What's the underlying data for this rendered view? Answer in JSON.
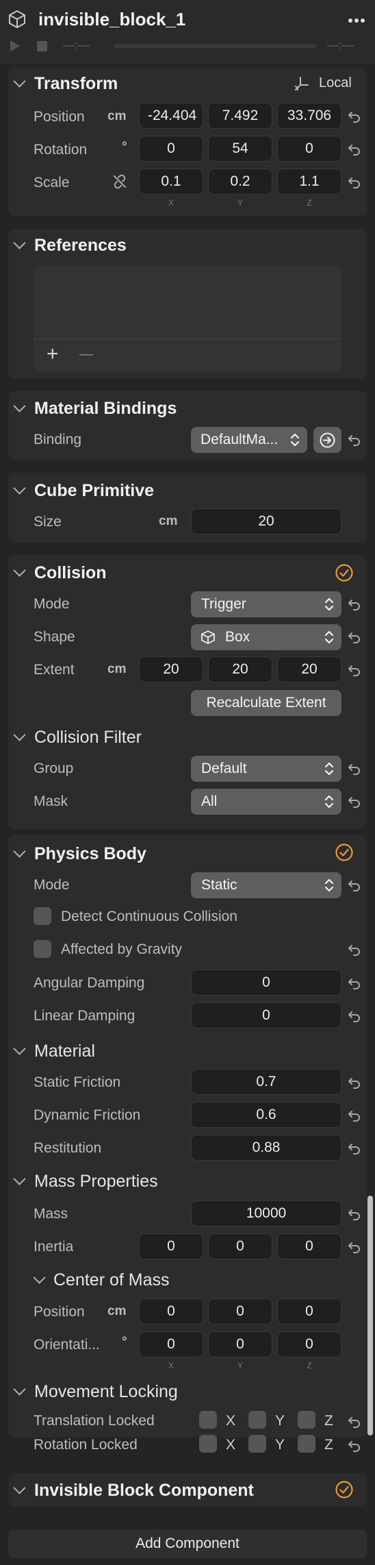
{
  "header": {
    "title": "invisible_block_1",
    "time_start": "—:—",
    "time_end": "—:—"
  },
  "transform": {
    "title": "Transform",
    "space": "Local",
    "position_label": "Position",
    "position_unit": "cm",
    "position": [
      "-24.404",
      "7.492",
      "33.706"
    ],
    "rotation_label": "Rotation",
    "rotation_unit": "°",
    "rotation": [
      "0",
      "54",
      "0"
    ],
    "scale_label": "Scale",
    "scale": [
      "0.1",
      "0.2",
      "1.1"
    ],
    "axes": [
      "X",
      "Y",
      "Z"
    ]
  },
  "references": {
    "title": "References",
    "add": "+",
    "remove": "—"
  },
  "material_bindings": {
    "title": "Material Bindings",
    "binding_label": "Binding",
    "binding_value": "DefaultMa..."
  },
  "cube_primitive": {
    "title": "Cube Primitive",
    "size_label": "Size",
    "size_unit": "cm",
    "size_value": "20"
  },
  "collision": {
    "title": "Collision",
    "mode_label": "Mode",
    "mode_value": "Trigger",
    "shape_label": "Shape",
    "shape_value": "Box",
    "extent_label": "Extent",
    "extent_unit": "cm",
    "extent": [
      "20",
      "20",
      "20"
    ],
    "recalc_label": "Recalculate Extent",
    "filter_title": "Collision Filter",
    "group_label": "Group",
    "group_value": "Default",
    "mask_label": "Mask",
    "mask_value": "All"
  },
  "physics_body": {
    "title": "Physics Body",
    "mode_label": "Mode",
    "mode_value": "Static",
    "continuous_label": "Detect Continuous Collision",
    "gravity_label": "Affected by Gravity",
    "angular_damping_label": "Angular Damping",
    "angular_damping": "0",
    "linear_damping_label": "Linear Damping",
    "linear_damping": "0",
    "material_title": "Material",
    "static_friction_label": "Static Friction",
    "static_friction": "0.7",
    "dynamic_friction_label": "Dynamic Friction",
    "dynamic_friction": "0.6",
    "restitution_label": "Restitution",
    "restitution": "0.88",
    "mass_title": "Mass Properties",
    "mass_label": "Mass",
    "mass": "10000",
    "inertia_label": "Inertia",
    "inertia": [
      "0",
      "0",
      "0"
    ],
    "com_title": "Center of Mass",
    "com_position_label": "Position",
    "com_position_unit": "cm",
    "com_position": [
      "0",
      "0",
      "0"
    ],
    "com_orientation_label": "Orientati...",
    "com_orientation_unit": "°",
    "com_orientation": [
      "0",
      "0",
      "0"
    ],
    "locking_title": "Movement Locking",
    "translation_locked_label": "Translation Locked",
    "rotation_locked_label": "Rotation Locked"
  },
  "invisible_block": {
    "title": "Invisible Block Component"
  },
  "footer": {
    "add_component": "Add Component"
  },
  "colors": {
    "accent": "#e89a3c",
    "panel": "#2c2c2c",
    "field": "#1f1f1f",
    "button": "#5e5e5e"
  }
}
